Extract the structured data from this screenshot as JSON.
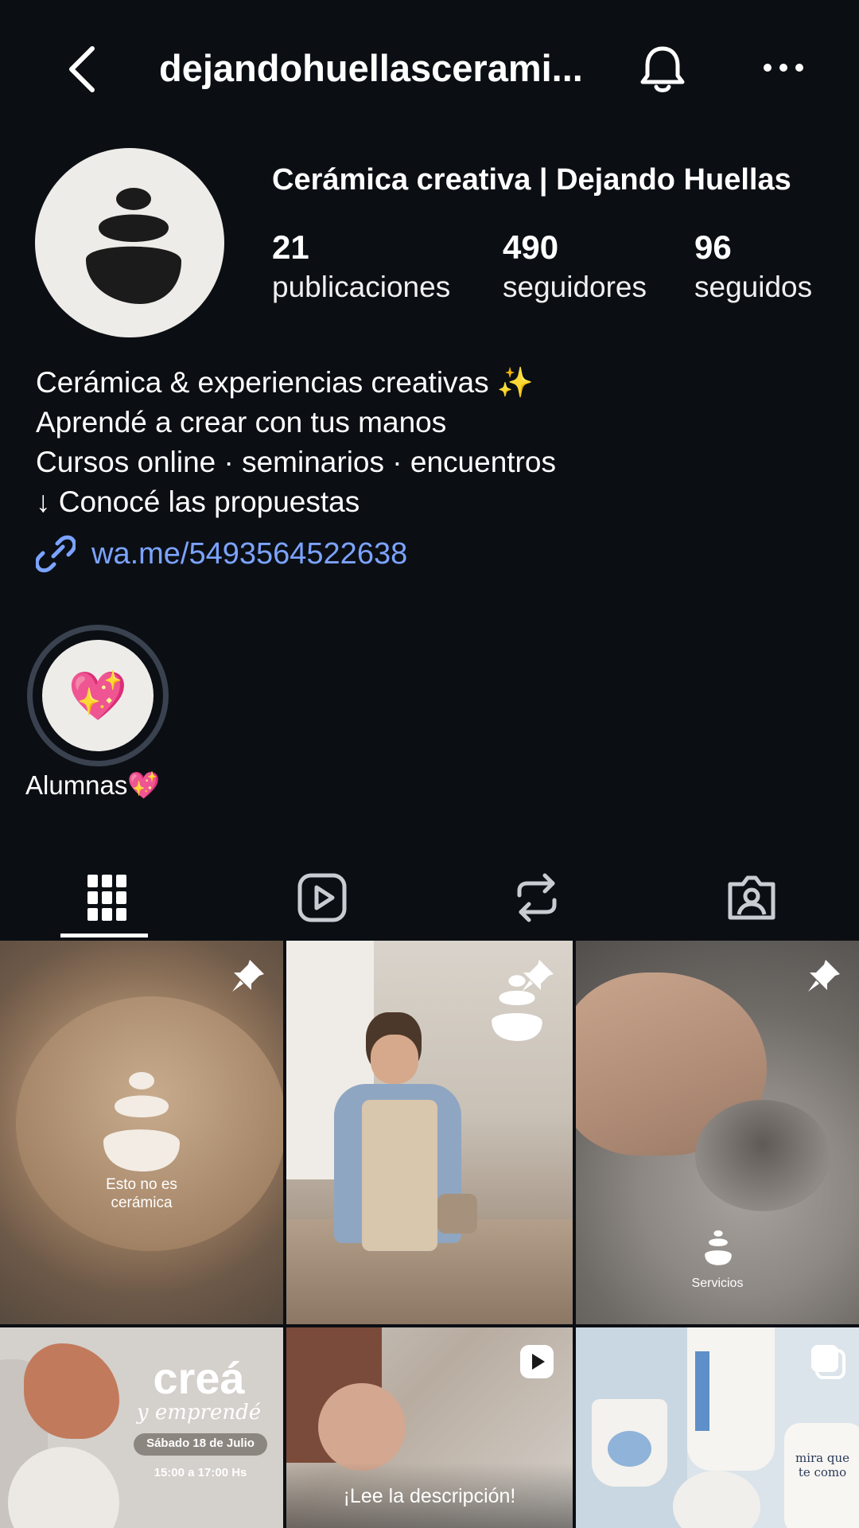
{
  "header": {
    "title": "dejandohuellascerami...",
    "back_icon": "chevron-left-icon",
    "bell_icon": "bell-icon",
    "more_icon": "more-horizontal-icon"
  },
  "profile": {
    "name": "Cerámica creativa | Dejando Huellas",
    "stats": [
      {
        "value": "21",
        "label": "publicaciones"
      },
      {
        "value": "490",
        "label": "seguidores"
      },
      {
        "value": "96",
        "label": "seguidos"
      }
    ],
    "bio": [
      "Cerámica & experiencias creativas ✨",
      "Aprendé a crear con tus manos",
      "Cursos online · seminarios · encuentros",
      "↓ Conocé las propuestas"
    ],
    "link": "wa.me/5493564522638"
  },
  "highlights": [
    {
      "label": "Alumnas💖",
      "emoji": "💖"
    }
  ],
  "tabs": [
    {
      "name": "grid",
      "icon": "grid-icon",
      "active": true
    },
    {
      "name": "reels",
      "icon": "reels-icon",
      "active": false
    },
    {
      "name": "reposts",
      "icon": "repost-icon",
      "active": false
    },
    {
      "name": "tagged",
      "icon": "tagged-icon",
      "active": false
    }
  ],
  "posts": [
    {
      "caption": "Esto no es cerámica",
      "caption_line1": "Esto no es",
      "caption_line2": "cerámica",
      "badge": "pin-icon"
    },
    {
      "caption": "",
      "badge": "pin-icon"
    },
    {
      "caption": "Servicios",
      "badge": "pin-icon"
    },
    {
      "caption": "creá y emprendé",
      "title1": "creá",
      "title2": "y emprendé",
      "date": "Sábado 18 de Julio",
      "time": "15:00 a 17:00 Hs",
      "badge": ""
    },
    {
      "caption": "¡Lee la descripción!",
      "badge": "reel-icon"
    },
    {
      "caption": "",
      "text_on_cup": "mira que te como",
      "badge": "carousel-icon"
    }
  ],
  "colors": {
    "background": "#0b0f14",
    "link": "#7ca3ff",
    "avatar_bg": "#eeece8"
  }
}
